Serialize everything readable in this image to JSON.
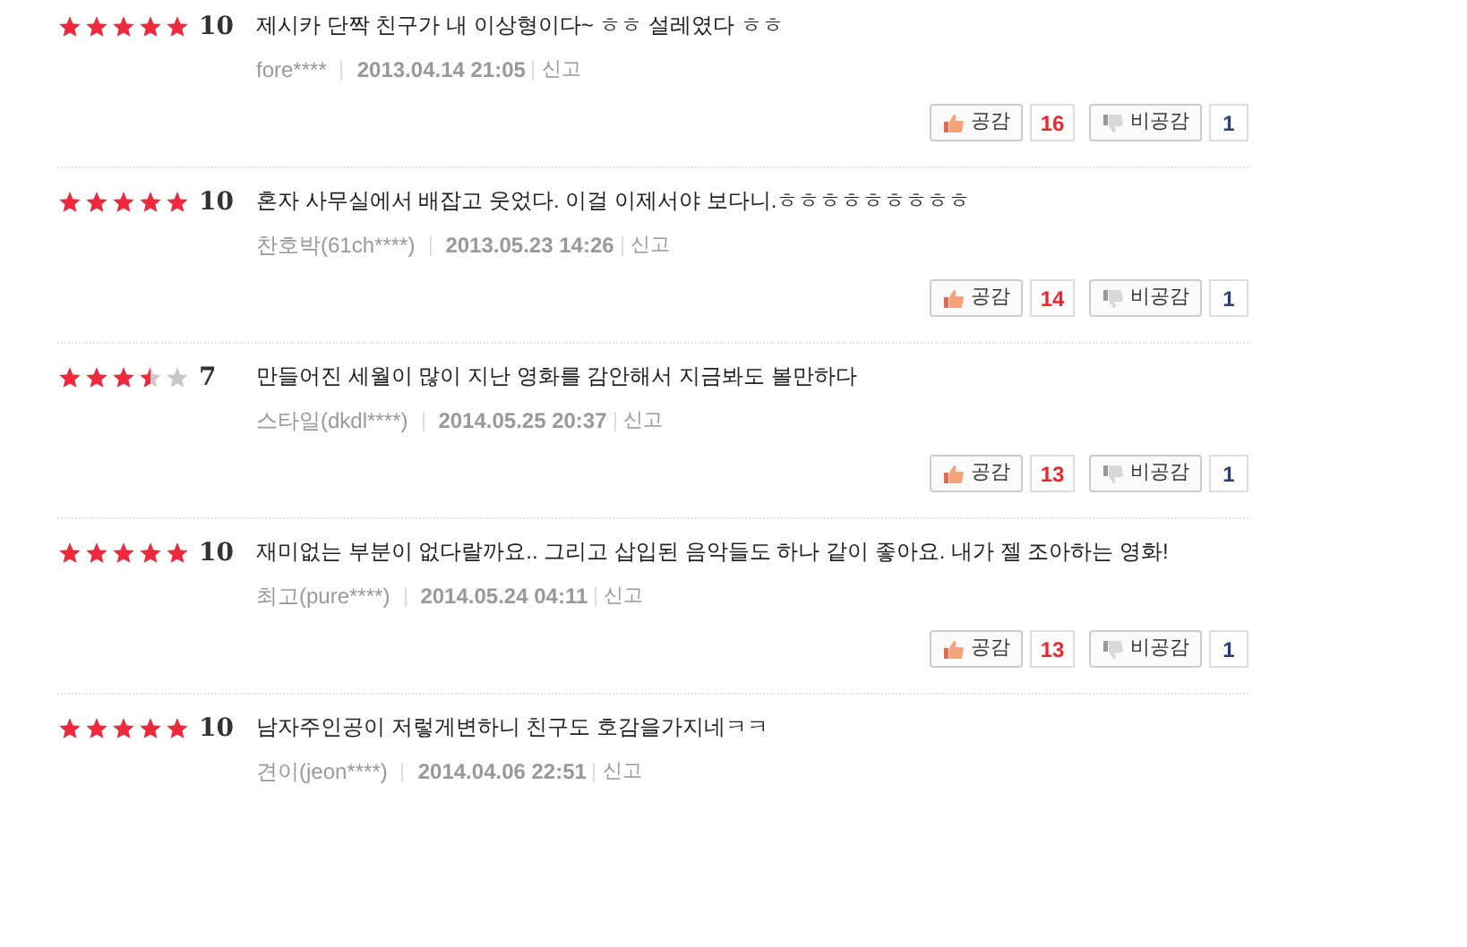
{
  "reviews": [
    {
      "stars": 5,
      "score": "10",
      "text": "제시카 단짝 친구가 내 이상형이다~ ㅎㅎ 설레였다 ㅎㅎ",
      "author": "fore****",
      "date": "2013.04.14 21:05",
      "report": "신고",
      "like_label": "공감",
      "likes": "16",
      "dislike_label": "비공감",
      "dislikes": "1"
    },
    {
      "stars": 5,
      "score": "10",
      "text": "혼자 사무실에서 배잡고 웃었다. 이걸 이제서야 보다니.ㅎㅎㅎㅎㅎㅎㅎㅎㅎ",
      "author": "찬호박(61ch****)",
      "date": "2013.05.23 14:26",
      "report": "신고",
      "like_label": "공감",
      "likes": "14",
      "dislike_label": "비공감",
      "dislikes": "1"
    },
    {
      "stars": 3.5,
      "score": "7",
      "text": "만들어진 세월이 많이 지난 영화를 감안해서 지금봐도 볼만하다",
      "author": "스타일(dkdl****)",
      "date": "2014.05.25 20:37",
      "report": "신고",
      "like_label": "공감",
      "likes": "13",
      "dislike_label": "비공감",
      "dislikes": "1"
    },
    {
      "stars": 5,
      "score": "10",
      "text": "재미없는 부분이 없다랄까요.. 그리고 삽입된 음악들도 하나 같이 좋아요. 내가 젤 조아하는 영화!",
      "author": "최고(pure****)",
      "date": "2014.05.24 04:11",
      "report": "신고",
      "like_label": "공감",
      "likes": "13",
      "dislike_label": "비공감",
      "dislikes": "1"
    },
    {
      "stars": 5,
      "score": "10",
      "text": "남자주인공이 저렇게변하니 친구도 호감을가지네ㅋㅋ",
      "author": "견이(jeon****)",
      "date": "2014.04.06 22:51",
      "report": "신고"
    }
  ]
}
